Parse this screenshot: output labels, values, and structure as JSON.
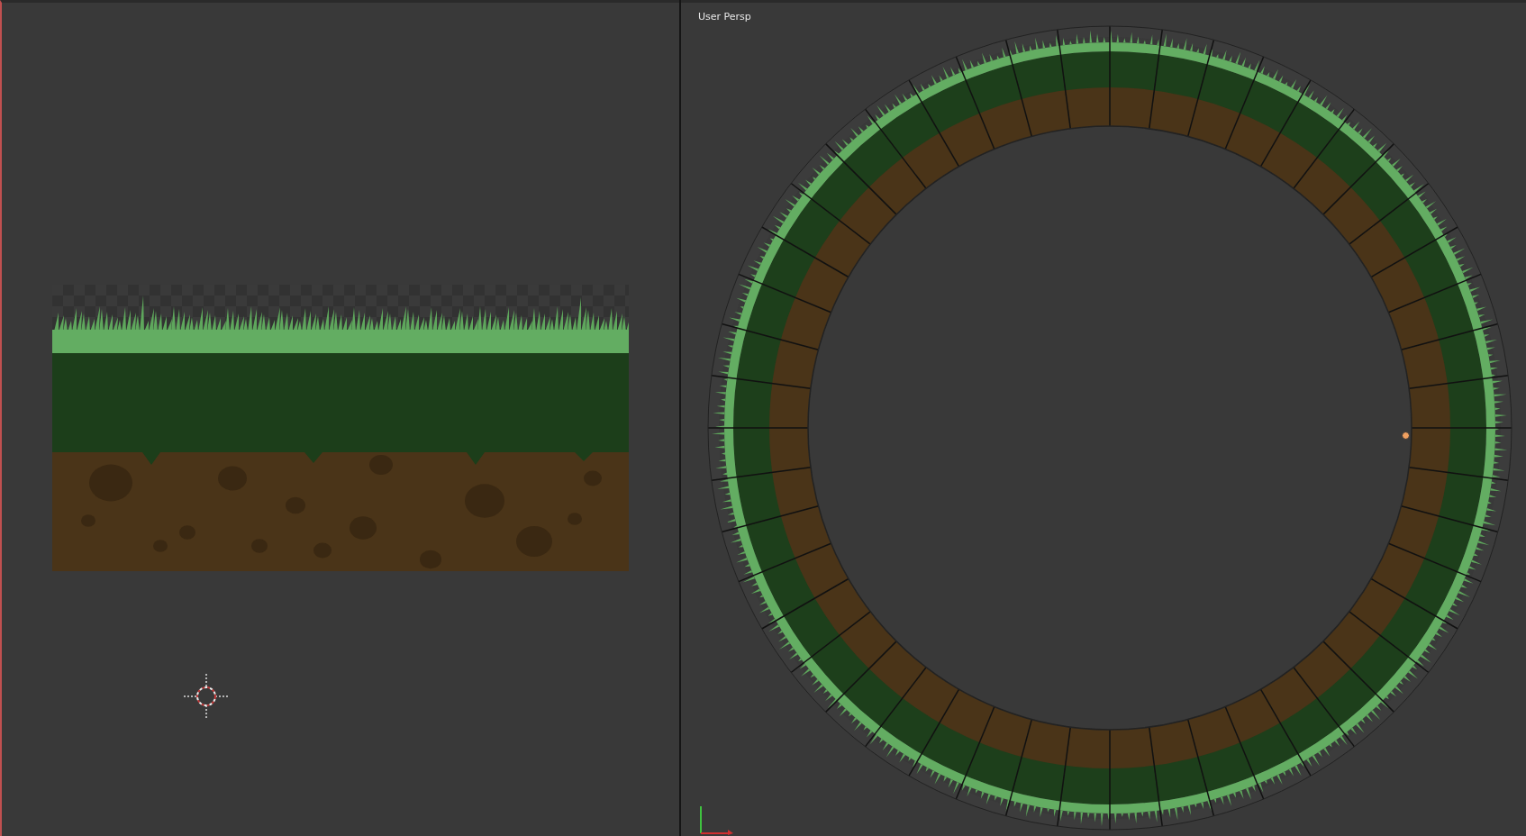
{
  "viewport": {
    "title": "User Persp"
  }
}
